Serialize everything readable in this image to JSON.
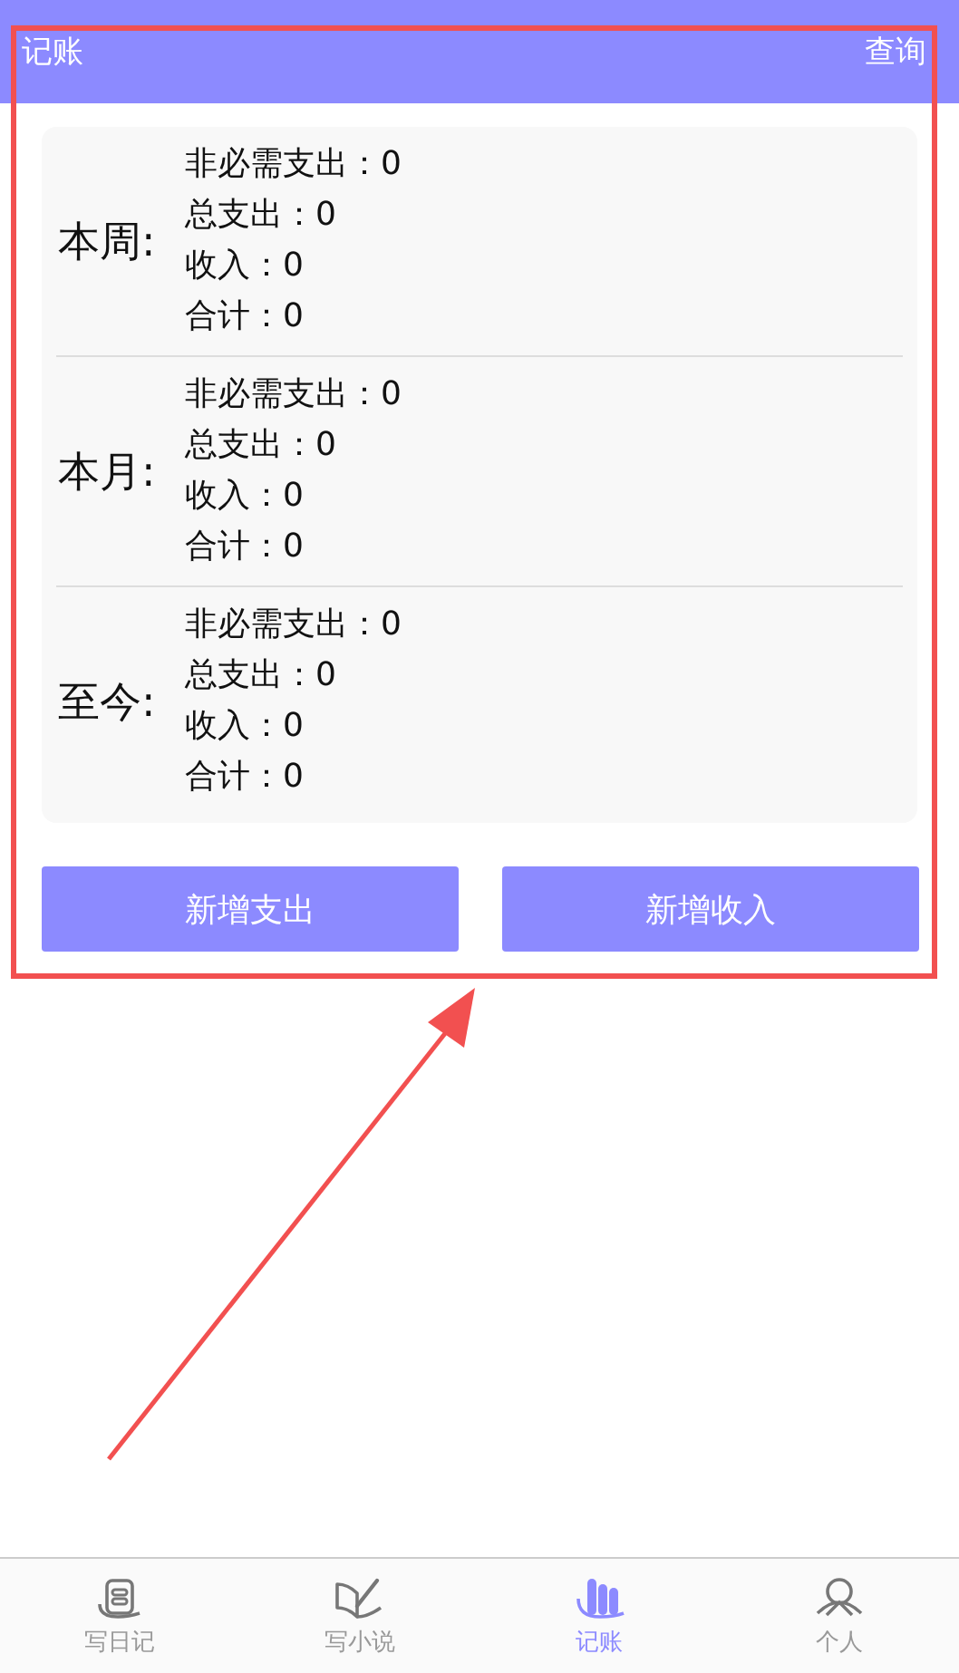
{
  "header": {
    "title": "记账",
    "action": "查询"
  },
  "periods": [
    {
      "label": "本周:",
      "lines": [
        "非必需支出：0",
        "总支出：0",
        "收入：0",
        "合计：0"
      ]
    },
    {
      "label": "本月:",
      "lines": [
        "非必需支出：0",
        "总支出：0",
        "收入：0",
        "合计：0"
      ]
    },
    {
      "label": "至今:",
      "lines": [
        "非必需支出：0",
        "总支出：0",
        "收入：0",
        "合计：0"
      ]
    }
  ],
  "buttons": [
    "新增支出",
    "新增收入"
  ],
  "tabs": [
    {
      "label": "写日记",
      "kind": "diary",
      "selected": false
    },
    {
      "label": "写小说",
      "kind": "novel",
      "selected": false
    },
    {
      "label": "记账",
      "kind": "ledger",
      "selected": true
    },
    {
      "label": "个人",
      "kind": "person",
      "selected": false
    }
  ]
}
